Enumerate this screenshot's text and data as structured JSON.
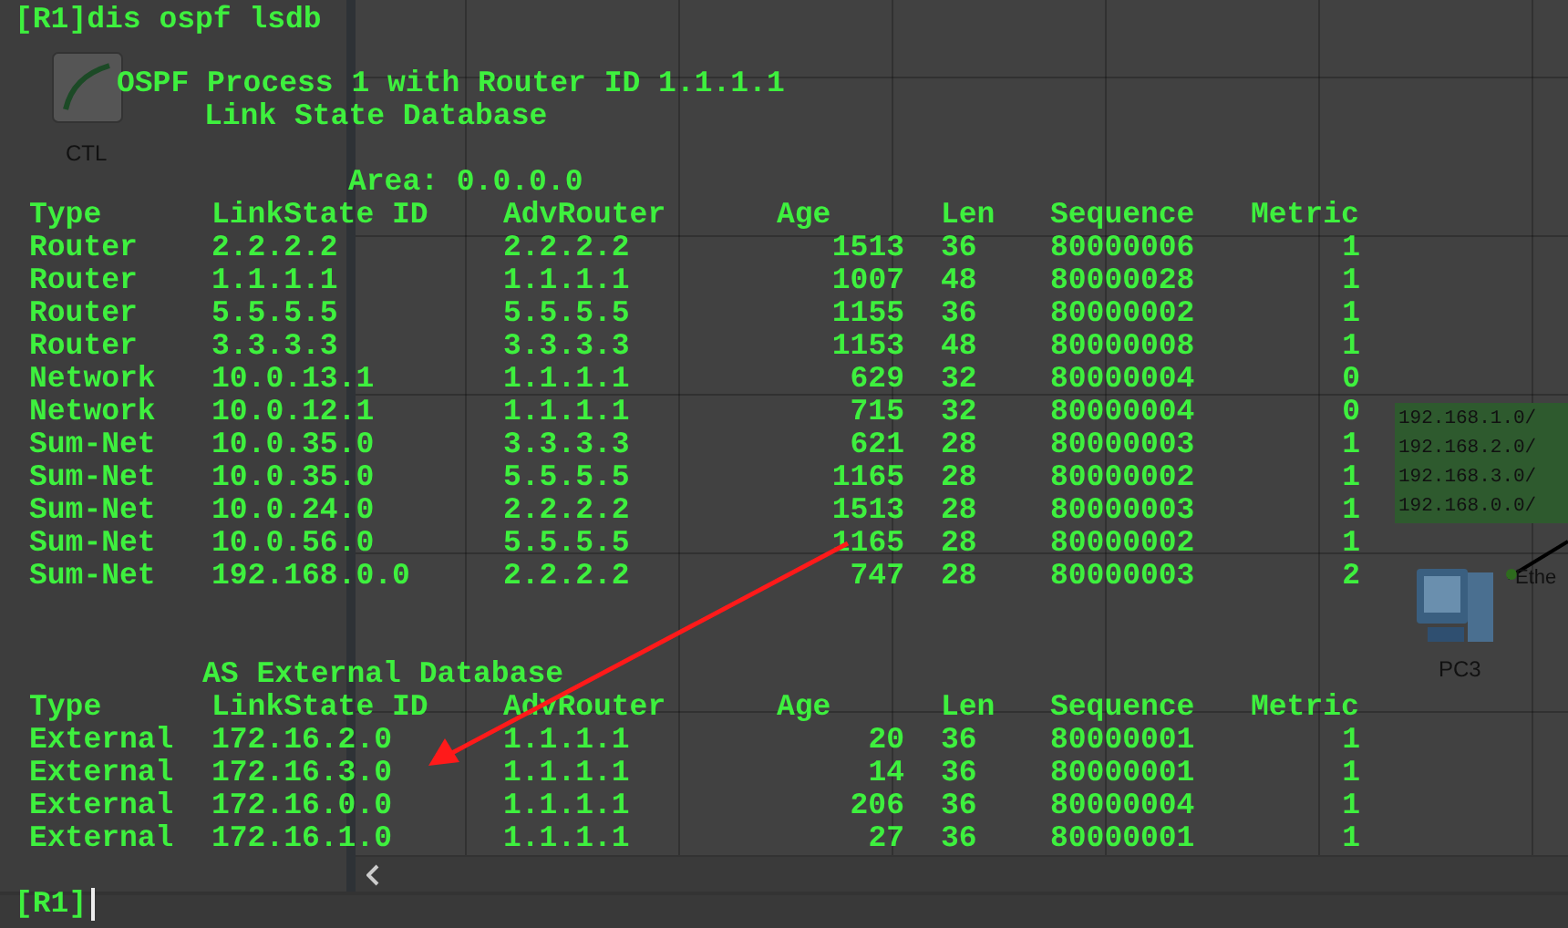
{
  "background": {
    "ctl_label": "CTL",
    "pc_label": "PC3",
    "port_label": "Ethe",
    "routes": [
      "192.168.1.0/",
      "192.168.2.0/",
      "192.168.3.0/",
      "192.168.0.0/"
    ]
  },
  "terminal": {
    "command": "[R1]dis ospf lsdb",
    "process_title": "OSPF Process 1 with Router ID 1.1.1.1",
    "database_title": "Link State Database",
    "area": "Area: 0.0.0.0",
    "lsdb": {
      "columns": [
        "Type",
        "LinkState ID",
        "AdvRouter",
        "Age",
        "Len",
        "Sequence",
        "Metric"
      ],
      "rows": [
        [
          "Router",
          "2.2.2.2",
          "2.2.2.2",
          "1513",
          "36",
          "80000006",
          "1"
        ],
        [
          "Router",
          "1.1.1.1",
          "1.1.1.1",
          "1007",
          "48",
          "80000028",
          "1"
        ],
        [
          "Router",
          "5.5.5.5",
          "5.5.5.5",
          "1155",
          "36",
          "80000002",
          "1"
        ],
        [
          "Router",
          "3.3.3.3",
          "3.3.3.3",
          "1153",
          "48",
          "80000008",
          "1"
        ],
        [
          "Network",
          "10.0.13.1",
          "1.1.1.1",
          "629",
          "32",
          "80000004",
          "0"
        ],
        [
          "Network",
          "10.0.12.1",
          "1.1.1.1",
          "715",
          "32",
          "80000004",
          "0"
        ],
        [
          "Sum-Net",
          "10.0.35.0",
          "3.3.3.3",
          "621",
          "28",
          "80000003",
          "1"
        ],
        [
          "Sum-Net",
          "10.0.35.0",
          "5.5.5.5",
          "1165",
          "28",
          "80000002",
          "1"
        ],
        [
          "Sum-Net",
          "10.0.24.0",
          "2.2.2.2",
          "1513",
          "28",
          "80000003",
          "1"
        ],
        [
          "Sum-Net",
          "10.0.56.0",
          "5.5.5.5",
          "1165",
          "28",
          "80000002",
          "1"
        ],
        [
          "Sum-Net",
          "192.168.0.0",
          "2.2.2.2",
          "747",
          "28",
          "80000003",
          "2"
        ]
      ]
    },
    "external_title": "AS External Database",
    "external": {
      "columns": [
        "Type",
        "LinkState ID",
        "AdvRouter",
        "Age",
        "Len",
        "Sequence",
        "Metric"
      ],
      "rows": [
        [
          "External",
          "172.16.2.0",
          "1.1.1.1",
          "20",
          "36",
          "80000001",
          "1"
        ],
        [
          "External",
          "172.16.3.0",
          "1.1.1.1",
          "14",
          "36",
          "80000001",
          "1"
        ],
        [
          "External",
          "172.16.0.0",
          "1.1.1.1",
          "206",
          "36",
          "80000004",
          "1"
        ],
        [
          "External",
          "172.16.1.0",
          "1.1.1.1",
          "27",
          "36",
          "80000001",
          "1"
        ]
      ]
    },
    "prompt": "[R1]"
  }
}
